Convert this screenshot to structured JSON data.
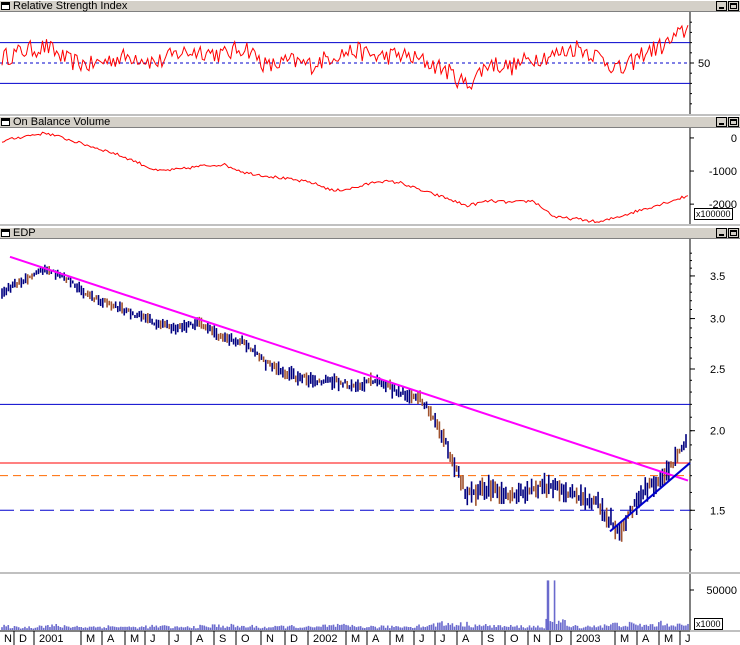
{
  "panels": {
    "rsi": {
      "title": "Relative Strength Index",
      "ticks": [
        "50"
      ],
      "levels": [
        70,
        50,
        30
      ]
    },
    "obv": {
      "title": "On Balance Volume",
      "ticks": [
        "0",
        "-1000",
        "-2000"
      ],
      "unit": "x100000"
    },
    "price": {
      "title": "EDP",
      "ticks": [
        "3.5",
        "3.0",
        "2.5",
        "2.0",
        "1.5"
      ]
    },
    "volume": {
      "ticks": [
        "50000"
      ],
      "unit": "x1000"
    }
  },
  "x_axis": {
    "labels": [
      "N",
      "D",
      "2001",
      "M",
      "A",
      "M",
      "J",
      "J",
      "A",
      "S",
      "O",
      "N",
      "D",
      "2002",
      "M",
      "A",
      "M",
      "J",
      "J",
      "A",
      "S",
      "O",
      "N",
      "D",
      "2003",
      "M",
      "A",
      "M",
      "J"
    ]
  },
  "colors": {
    "price_bars": "#000080",
    "price_down": "#a0522d",
    "resistance_trendline": "#ff00ff",
    "support_trendline": "#0000cd",
    "horizontal_blue": "#0000cd",
    "horizontal_red": "#ff0000",
    "horizontal_orange_dashed": "#ff6a00",
    "rsi_line": "#ff0000",
    "obv_line": "#ff0000",
    "volume_bars": "#6a6acd"
  },
  "chart_data": [
    {
      "type": "line",
      "title": "Relative Strength Index",
      "ylim": [
        0,
        100
      ],
      "reference_lines": [
        70,
        50,
        30
      ],
      "x": [
        "2000-11",
        "2000-12",
        "2001-01",
        "2001-02",
        "2001-03",
        "2001-04",
        "2001-05",
        "2001-06",
        "2001-07",
        "2001-08",
        "2001-09",
        "2001-10",
        "2001-11",
        "2001-12",
        "2002-01",
        "2002-02",
        "2002-03",
        "2002-04",
        "2002-05",
        "2002-06",
        "2002-07",
        "2002-08",
        "2002-09",
        "2002-10",
        "2002-11",
        "2002-12",
        "2003-01",
        "2003-02",
        "2003-03",
        "2003-04",
        "2003-05",
        "2003-06"
      ],
      "series": [
        {
          "values": [
            55,
            62,
            66,
            52,
            48,
            54,
            57,
            50,
            60,
            62,
            58,
            66,
            46,
            52,
            48,
            58,
            62,
            56,
            58,
            52,
            44,
            28,
            50,
            46,
            55,
            58,
            66,
            56,
            42,
            60,
            68,
            84
          ]
        }
      ]
    },
    {
      "type": "line",
      "title": "On Balance Volume",
      "ylabel": "x100000",
      "ylim": [
        -2600,
        300
      ],
      "x": [
        "2000-11",
        "2000-12",
        "2001-01",
        "2001-02",
        "2001-03",
        "2001-04",
        "2001-05",
        "2001-06",
        "2001-07",
        "2001-08",
        "2001-09",
        "2001-10",
        "2001-11",
        "2001-12",
        "2002-01",
        "2002-02",
        "2002-03",
        "2002-04",
        "2002-05",
        "2002-06",
        "2002-07",
        "2002-08",
        "2002-09",
        "2002-10",
        "2002-11",
        "2002-12",
        "2003-01",
        "2003-02",
        "2003-03",
        "2003-04",
        "2003-05",
        "2003-06"
      ],
      "series": [
        {
          "values": [
            -100,
            50,
            150,
            -50,
            -250,
            -450,
            -700,
            -1000,
            -950,
            -850,
            -800,
            -1050,
            -1150,
            -1250,
            -1350,
            -1600,
            -1500,
            -1300,
            -1350,
            -1600,
            -1800,
            -2050,
            -1900,
            -1950,
            -1900,
            -2400,
            -2450,
            -2550,
            -2350,
            -2150,
            -1950,
            -1750
          ]
        }
      ]
    },
    {
      "type": "bar",
      "title": "EDP",
      "ylim": [
        1.2,
        4.0
      ],
      "log_scale": true,
      "x": [
        "2000-11",
        "2000-12",
        "2001-01",
        "2001-02",
        "2001-03",
        "2001-04",
        "2001-05",
        "2001-06",
        "2001-07",
        "2001-08",
        "2001-09",
        "2001-10",
        "2001-11",
        "2001-12",
        "2002-01",
        "2002-02",
        "2002-03",
        "2002-04",
        "2002-05",
        "2002-06",
        "2002-07",
        "2002-08",
        "2002-09",
        "2002-10",
        "2002-11",
        "2002-12",
        "2003-01",
        "2003-02",
        "2003-03",
        "2003-04",
        "2003-05",
        "2003-06"
      ],
      "series": [
        {
          "values": [
            3.3,
            3.45,
            3.6,
            3.45,
            3.25,
            3.15,
            3.05,
            2.95,
            2.9,
            2.95,
            2.8,
            2.75,
            2.55,
            2.45,
            2.4,
            2.4,
            2.35,
            2.4,
            2.3,
            2.25,
            1.95,
            1.6,
            1.62,
            1.58,
            1.62,
            1.64,
            1.58,
            1.54,
            1.38,
            1.6,
            1.7,
            1.92
          ]
        }
      ],
      "trendlines": [
        {
          "name": "resistance",
          "from": [
            "2000-11",
            3.75
          ],
          "to": [
            "2003-06",
            1.67
          ]
        },
        {
          "name": "support",
          "from": [
            "2003-02",
            1.39
          ],
          "to": [
            "2003-06",
            1.78
          ]
        }
      ],
      "reference_lines": [
        2.2,
        1.78,
        1.7,
        1.5
      ]
    },
    {
      "type": "bar",
      "ylabel": "x1000",
      "ylim": [
        0,
        70000
      ],
      "x": [
        "2000-11",
        "2000-12",
        "2001-01",
        "2001-02",
        "2001-03",
        "2001-04",
        "2001-05",
        "2001-06",
        "2001-07",
        "2001-08",
        "2001-09",
        "2001-10",
        "2001-11",
        "2001-12",
        "2002-01",
        "2002-02",
        "2002-03",
        "2002-04",
        "2002-05",
        "2002-06",
        "2002-07",
        "2002-08",
        "2002-09",
        "2002-10",
        "2002-11",
        "2002-12",
        "2003-01",
        "2003-02",
        "2003-03",
        "2003-04",
        "2003-05",
        "2003-06"
      ],
      "series": [
        {
          "values": [
            5000,
            4000,
            6000,
            5000,
            4500,
            5000,
            4000,
            5000,
            4000,
            5000,
            6000,
            5000,
            4000,
            5000,
            4000,
            6000,
            5000,
            4500,
            5000,
            6000,
            9000,
            8000,
            6000,
            5000,
            5000,
            62000,
            5000,
            6000,
            8000,
            7000,
            9000,
            7000
          ]
        }
      ]
    }
  ]
}
